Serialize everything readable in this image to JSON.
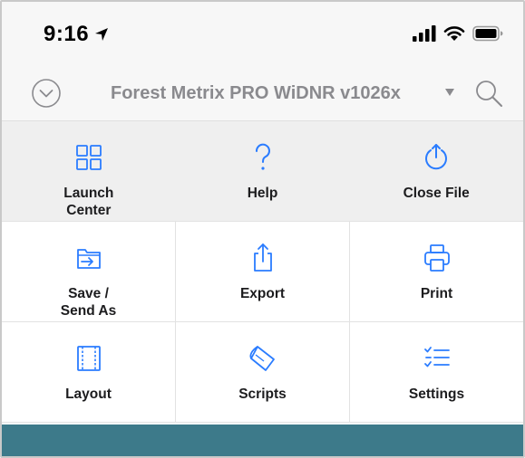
{
  "status_bar": {
    "time": "9:16",
    "icons": [
      "location-arrow-icon",
      "cellular-signal-icon",
      "wifi-icon",
      "battery-icon"
    ]
  },
  "title_bar": {
    "title": "Forest Metrix PRO WiDNR v1026x",
    "left_icon": "chevron-down-circle-icon",
    "right_icon": "search-icon"
  },
  "menu": {
    "rows": [
      [
        {
          "label": "Launch\nCenter",
          "icon": "grid-icon"
        },
        {
          "label": "Help",
          "icon": "question-icon"
        },
        {
          "label": "Close File",
          "icon": "power-icon"
        }
      ],
      [
        {
          "label": "Save /\nSend As",
          "icon": "folder-arrow-icon"
        },
        {
          "label": "Export",
          "icon": "share-icon"
        },
        {
          "label": "Print",
          "icon": "printer-icon"
        }
      ],
      [
        {
          "label": "Layout",
          "icon": "layout-icon"
        },
        {
          "label": "Scripts",
          "icon": "scroll-icon"
        },
        {
          "label": "Settings",
          "icon": "checklist-icon"
        }
      ]
    ]
  },
  "colors": {
    "accent": "#2a7cff",
    "title_gray": "#8a8a8e",
    "bottom_bar": "#3d7a8a"
  }
}
